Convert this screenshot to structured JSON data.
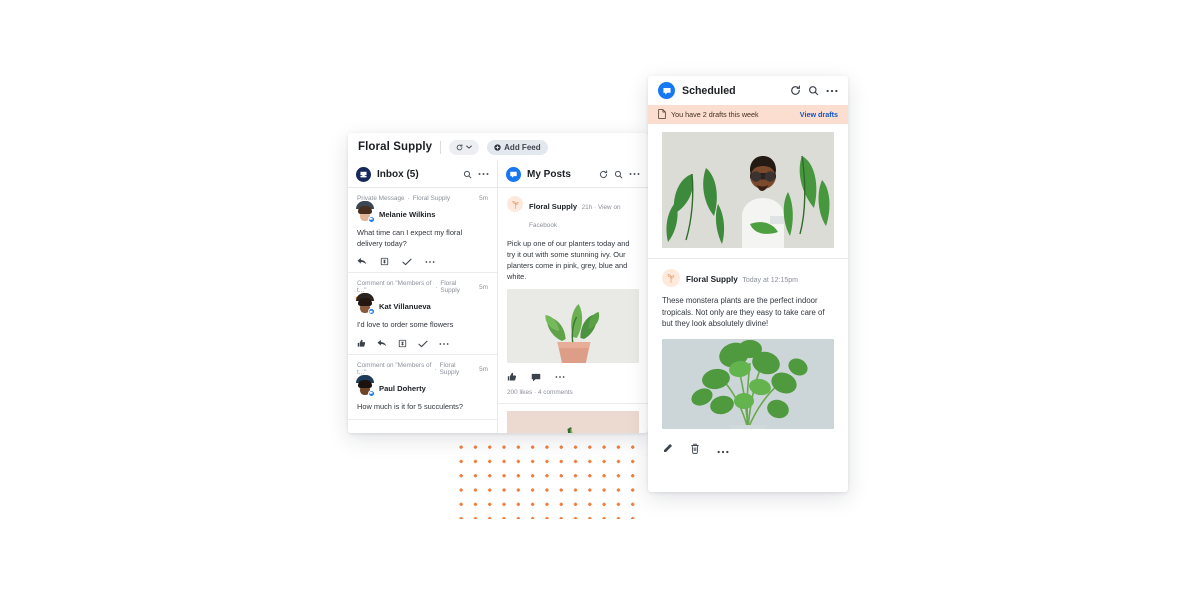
{
  "workspace": {
    "title": "Floral Supply",
    "refresh_label": "refresh",
    "add_feed_label": "Add Feed"
  },
  "inbox_pane": {
    "title": "Inbox (5)",
    "icon": "inbox-icon",
    "search_icon": "search-icon",
    "more_icon": "more-horizontal-icon",
    "items": [
      {
        "type": "Private Message",
        "source": "Floral Supply",
        "time": "5m",
        "sender": "Melanie Wilkins",
        "message": "What time can I expect my floral delivery today?",
        "actions": [
          "reply-icon",
          "archive-icon",
          "check-icon",
          "more-horizontal-icon"
        ]
      },
      {
        "type": "Comment on \"Members of t...\"",
        "source": "Floral Supply",
        "time": "5m",
        "sender": "Kat Villanueva",
        "message": "I'd love to order some flowers",
        "actions": [
          "like-icon",
          "reply-icon",
          "archive-icon",
          "check-icon",
          "more-horizontal-icon"
        ]
      },
      {
        "type": "Comment on \"Members of t...\"",
        "source": "Floral Supply",
        "time": "5m",
        "sender": "Paul Doherty",
        "message": "How much is it for 5 succulents?",
        "actions": []
      }
    ]
  },
  "posts_pane": {
    "title": "My Posts",
    "icon": "messenger-icon",
    "refresh_icon": "refresh-icon",
    "search_icon": "search-icon",
    "more_icon": "more-horizontal-icon",
    "posts": [
      {
        "author": "Floral Supply",
        "time": "21h",
        "separator": "·",
        "link": "View on Facebook",
        "body": "Pick up one of our planters today and try it out with some stunning ivy. Our planters come in pink, grey, blue and white.",
        "image": "potted-ivy-photo",
        "actions": [
          "like-icon",
          "comment-icon",
          "more-horizontal-icon"
        ],
        "likes": "200 likes",
        "stats_separator": "·",
        "comments": "4 comments"
      },
      {
        "author": "",
        "time": "",
        "separator": "",
        "link": "",
        "body": "",
        "image": "palm-leaf-photo",
        "actions": [],
        "likes": "",
        "stats_separator": "",
        "comments": ""
      }
    ]
  },
  "scheduled_window": {
    "title": "Scheduled",
    "icon": "messenger-icon",
    "refresh_icon": "refresh-icon",
    "search_icon": "search-icon",
    "more_icon": "more-horizontal-icon",
    "banner": {
      "icon": "document-icon",
      "text": "You have 2 drafts this week",
      "link": "View drafts"
    },
    "hero_image": "man-with-plants-photo",
    "post": {
      "author": "Floral Supply",
      "time": "Today at 12:15pm",
      "body": "These monstera plants are the perfect indoor tropicals. Not only are they easy to take care of but they look absolutely divine!",
      "image": "monstera-plant-photo"
    },
    "actions": [
      "edit-icon",
      "delete-icon",
      "more-horizontal-icon"
    ]
  },
  "decoration": {
    "dot_grid_color": "#ef7f3f"
  }
}
